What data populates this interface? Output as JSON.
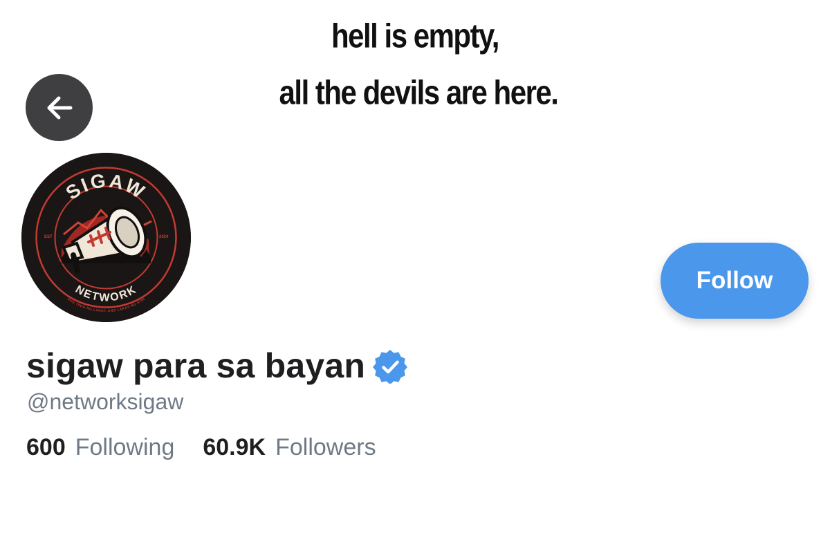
{
  "banner": {
    "line_1": "hell is empty,",
    "line_2": "all the devils are here."
  },
  "navigation": {
    "back_icon": "arrow-left-icon"
  },
  "avatar": {
    "text_top": "SIGAW",
    "text_bottom": "NETWORK",
    "text_left": "EST",
    "text_right": "2024",
    "tagline": "ANG TINIG NG LAHAT, ANG LAKAS NG ATIN",
    "emblem_icon": "megaphone-icon",
    "colors": {
      "background": "#1b1616",
      "accent": "#c43a31",
      "cream": "#f0e7d8"
    }
  },
  "profile": {
    "display_name": "sigaw para sa bayan",
    "verified_icon": "verified-badge-icon",
    "handle": "@networksigaw",
    "follow_label": "Follow",
    "following_count": "600",
    "following_label": "Following",
    "followers_count": "60.9K",
    "followers_label": "Followers"
  },
  "colors": {
    "follow_button": "#4a97eb",
    "verified_badge": "#4a97eb",
    "back_button": "#3f3f41",
    "secondary_text": "#707a86",
    "primary_text": "#1f1f21"
  }
}
